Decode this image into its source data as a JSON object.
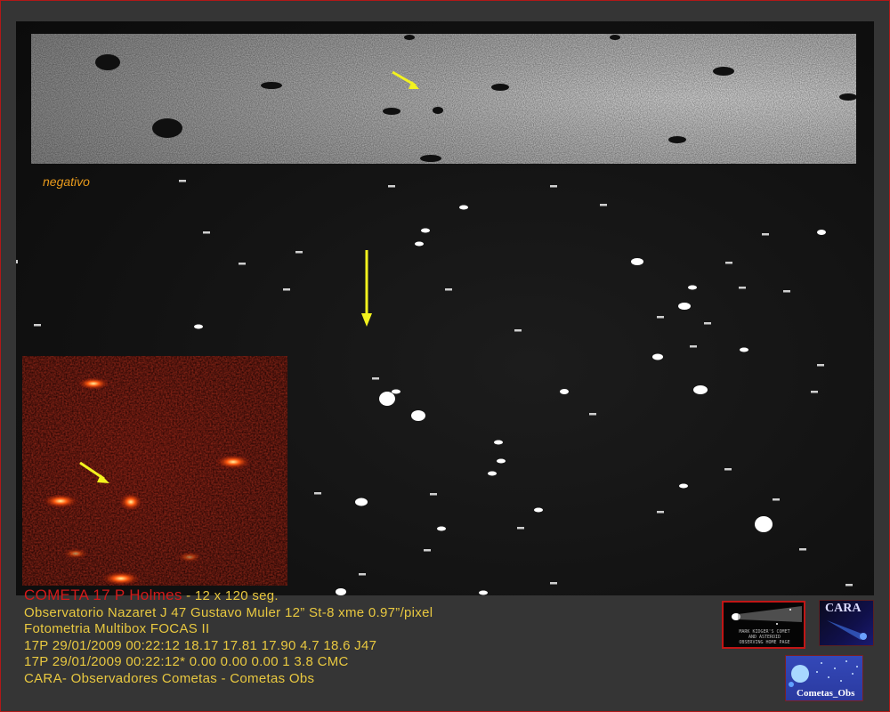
{
  "negative_caption": "negativo",
  "info": {
    "title": "COMETA 17 P Holmes",
    "title_suffix": " - 12 x 120 seg.",
    "lines": [
      "Observatorio Nazaret J 47 Gustavo Muler 12” St-8 xme 0.97”/pixel",
      "Fotometria Multibox FOCAS II",
      "17P 29/01/2009 00:22:12 18.17 17.81 17.90 4.7 18.6 J47",
      "17P 29/01/2009 00:22:12* 0.00 0.00 0.00 1 3.8 CMC",
      "CARA- Observadores Cometas - Cometas Obs"
    ]
  },
  "logos": {
    "kidger": {
      "text_lines": [
        "MARK KIDGER'S COMET",
        "AND ASTEROID",
        "OBSERVING HOME PAGE"
      ]
    },
    "cara": {
      "text": "CARA"
    },
    "cometas_obs": {
      "text": "Cometas_Obs"
    }
  },
  "colors": {
    "arrow": "#f2f21e",
    "caption": "#e89a1c",
    "title_red": "#d21a1a",
    "info_text": "#e8c840",
    "frame_border": "#b01818"
  }
}
